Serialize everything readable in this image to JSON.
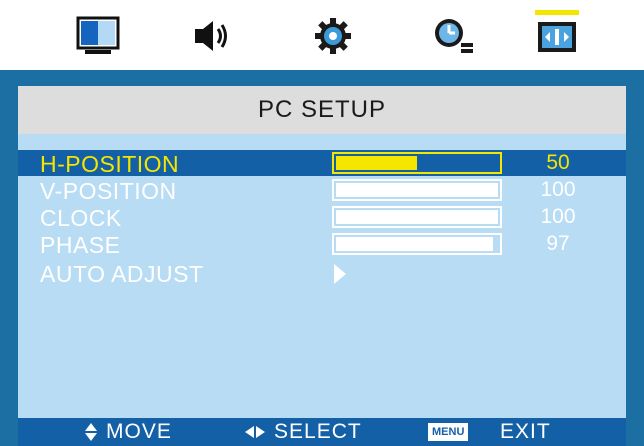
{
  "menu_tabs": [
    {
      "icon": "monitor-icon",
      "active": false
    },
    {
      "icon": "speaker-icon",
      "active": false
    },
    {
      "icon": "gear-icon",
      "active": false
    },
    {
      "icon": "clock-icon",
      "active": false
    },
    {
      "icon": "pc-setup-icon",
      "active": true
    }
  ],
  "title": "PC SETUP",
  "settings": [
    {
      "label": "H-POSITION",
      "value": "50",
      "level": 0.5,
      "selected": true
    },
    {
      "label": "V-POSITION",
      "value": "100",
      "level": 1.0,
      "selected": false
    },
    {
      "label": "CLOCK",
      "value": "100",
      "level": 1.0,
      "selected": false
    },
    {
      "label": "PHASE",
      "value": "97",
      "level": 0.97,
      "selected": false
    },
    {
      "label": "AUTO ADJUST",
      "value": "",
      "selected": false,
      "action": "arrow-right-icon"
    }
  ],
  "help": {
    "move": "MOVE",
    "select": "SELECT",
    "menu_key": "MENU",
    "exit": "EXIT"
  },
  "colors": {
    "accent": "#f5e600",
    "frame": "#1b6fa3",
    "panel": "#b7dcf3",
    "highlight": "#1360a6",
    "title_bar": "#dddddd"
  }
}
